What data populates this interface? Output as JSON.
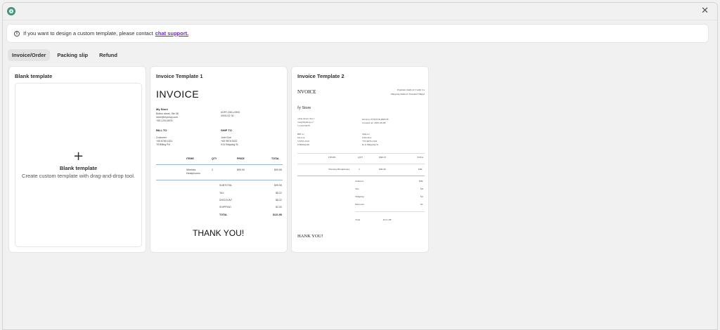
{
  "banner": {
    "text": "If you want to design a custom template, please contact",
    "link": "chat support."
  },
  "tabs": [
    {
      "label": "Invoice/Order",
      "active": true
    },
    {
      "label": "Packing slip",
      "active": false
    },
    {
      "label": "Refund",
      "active": false
    }
  ],
  "cards": {
    "blank": {
      "title": "Blank template",
      "heading": "Blank template",
      "description": "Create custom template with drag-and-drop tool."
    },
    "t1": {
      "title": "Invoice Template 1",
      "invoice": "INVOICE",
      "store": "My Store",
      "addr1": "Bolton street, Ste 08",
      "addr2": "store@myshop.com",
      "addr3": "+65 1234 5678",
      "ord1": "#ORT-2601-0900",
      "ord2": "09/01/22 30",
      "bill_to": "BILL TO",
      "ship_to": "SHIP TO",
      "bill1": "Customer",
      "bill2": "+65 8765 4321",
      "bill3": "78 Billing Rd",
      "ship1": "John Doe",
      "ship2": "+65 9876 5432",
      "ship3": "ICA Shipping St",
      "col_items": "ITEMS",
      "col_qty": "QTY",
      "col_price": "PRICE",
      "col_total": "TOTAL",
      "item_name": "Wireless",
      "item_name2": "Headphones",
      "item_qty": "2",
      "item_price": "$99.99",
      "item_total": "$99.98",
      "subtotal_l": "SUBTOTAL",
      "subtotal_v": "$99.98",
      "tax_l": "TAX",
      "tax_v": "$8.22",
      "discount_l": "DISCOUNT",
      "discount_v": "$8.22",
      "shipping_l": "SHIPPING",
      "shipping_v": "$2.00",
      "total_l": "TOTAL",
      "total_v": "$121.98",
      "thank": "THANK YOU!"
    },
    "t2": {
      "title": "Invoice Template 2",
      "invoice": "NVOICE",
      "right1": "Payment method: Credit Ca",
      "right2": "Shipping method: Standard Shippi",
      "store": "fy Store",
      "addr1": "olton street, Ste 1",
      "addr2": "ore@myshop.cc",
      "addr3": "5 1234 5678",
      "inv1": "Invoice: FYNTY6-090578",
      "inv2": "Created on: 2025-09-08",
      "bill": "Bill to:",
      "ship": "Ship to:",
      "bill1": "ine Lee",
      "bill2": "5 8765 4321",
      "bill3": "8 Billing Rd",
      "ship1": "John Doe",
      "ship2": "+65 9876 5432",
      "ship3": "ICA Shipping St",
      "col_items": "ITEMS",
      "col_qty": "QTY",
      "col_price": "PRICE",
      "col_total": "TOTA",
      "item_name": "Wireless Headphones",
      "item_qty": "2",
      "item_price": "$99.99",
      "item_total": "$99.",
      "subtotal_l": "Subtotal",
      "subtotal_v": "$99.",
      "tax_l": "Tax",
      "tax_v": "$8.",
      "shipping_l": "Shipping",
      "shipping_v": "$2.",
      "discount_l": "Discount",
      "discount_v": "-$1.",
      "total_l": "Total",
      "total_v": "$121.98",
      "thank": "HANK YOU!"
    }
  }
}
